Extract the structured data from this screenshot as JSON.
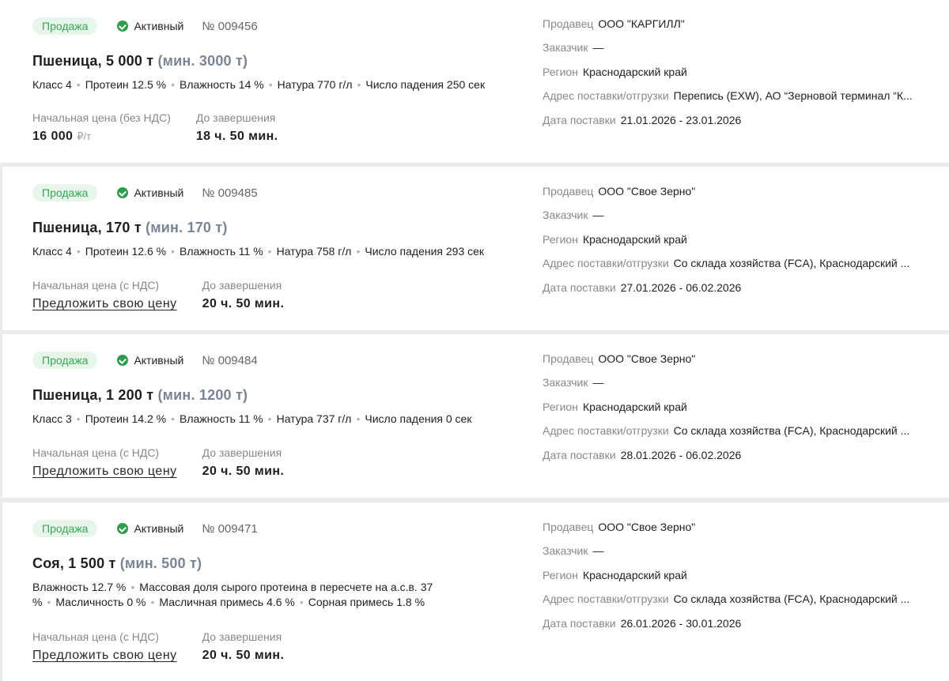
{
  "labels": {
    "seller": "Продавец",
    "customer": "Заказчик",
    "region": "Регион",
    "address": "Адрес поставки/отгрузки",
    "delivery_date": "Дата поставки",
    "until_end": "До завершения",
    "offer_price": "Предложить свою цену"
  },
  "lots": [
    {
      "badge": "Продажа",
      "status": "Активный",
      "number": "№ 009456",
      "title": "Пшеница, 5 000 т",
      "title_min": "(мин. 3000 т)",
      "props": [
        "Класс 4",
        "Протеин 12.5 %",
        "Влажность 14 %",
        "Натура 770 г/л",
        "Число падения 250 сек"
      ],
      "price_label": "Начальная цена (без НДС)",
      "price_value": "16 000",
      "price_unit": "₽/т",
      "time_left": "18 ч. 50 мин.",
      "seller": "ООО \"КАРГИЛЛ\"",
      "customer": "—",
      "region": "Краснодарский край",
      "address": "Перепись (EXW), АО “Зерновой терминал “К...",
      "delivery_date": "21.01.2026 - 23.01.2026"
    },
    {
      "badge": "Продажа",
      "status": "Активный",
      "number": "№ 009485",
      "title": "Пшеница, 170 т",
      "title_min": "(мин. 170 т)",
      "props": [
        "Класс 4",
        "Протеин 12.6 %",
        "Влажность 11 %",
        "Натура 758 г/л",
        "Число падения 293 сек"
      ],
      "price_label": "Начальная цена (с НДС)",
      "time_left": "20 ч. 50 мин.",
      "seller": "ООО \"Свое Зерно\"",
      "customer": "—",
      "region": "Краснодарский край",
      "address": "Со склада хозяйства (FCA), Краснодарский ...",
      "delivery_date": "27.01.2026 - 06.02.2026"
    },
    {
      "badge": "Продажа",
      "status": "Активный",
      "number": "№ 009484",
      "title": "Пшеница, 1 200 т",
      "title_min": "(мин. 1200 т)",
      "props": [
        "Класс 3",
        "Протеин 14.2 %",
        "Влажность 11 %",
        "Натура 737 г/л",
        "Число падения 0 сек"
      ],
      "price_label": "Начальная цена (с НДС)",
      "time_left": "20 ч. 50 мин.",
      "seller": "ООО \"Свое Зерно\"",
      "customer": "—",
      "region": "Краснодарский край",
      "address": "Со склада хозяйства (FCA), Краснодарский ...",
      "delivery_date": "28.01.2026 - 06.02.2026"
    },
    {
      "badge": "Продажа",
      "status": "Активный",
      "number": "№ 009471",
      "title": "Соя, 1 500 т",
      "title_min": "(мин. 500 т)",
      "props": [
        "Влажность 12.7 %",
        "Массовая доля сырого протеина в пересчете на а.с.в. 37 %",
        "Масличность 0 %",
        "Масличная примесь 4.6 %",
        "Сорная примесь 1.8 %"
      ],
      "price_label": "Начальная цена (с НДС)",
      "time_left": "20 ч. 50 мин.",
      "seller": "ООО \"Свое Зерно\"",
      "customer": "—",
      "region": "Краснодарский край",
      "address": "Со склада хозяйства (FCA), Краснодарский ...",
      "delivery_date": "26.01.2026 - 30.01.2026"
    }
  ]
}
